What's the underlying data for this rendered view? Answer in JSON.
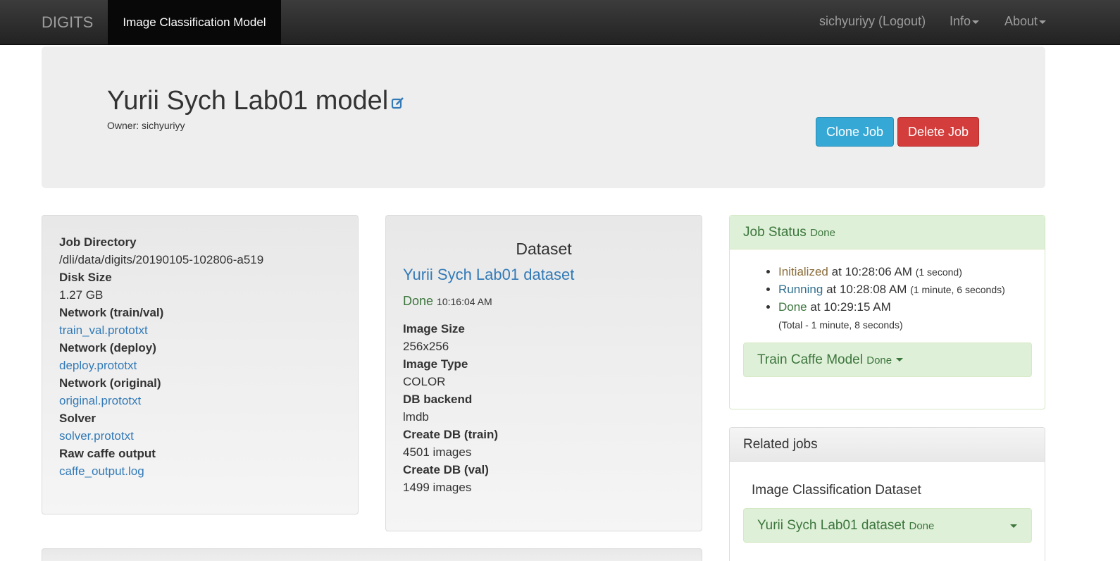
{
  "navbar": {
    "brand": "DIGITS",
    "active_tab": "Image Classification Model",
    "user": "sichyuriyy (Logout)",
    "info": "Info",
    "about": "About"
  },
  "header": {
    "title": "Yurii Sych Lab01 model",
    "owner": "Owner: sichyuriyy",
    "clone_label": "Clone Job",
    "delete_label": "Delete Job"
  },
  "job_info": {
    "items": [
      {
        "label": "Job Directory",
        "value": "/dli/data/digits/20190105-102806-a519"
      },
      {
        "label": "Disk Size",
        "value": "1.27 GB"
      },
      {
        "label": "Network (train/val)",
        "value": "train_val.prototxt"
      },
      {
        "label": "Network (deploy)",
        "value": "deploy.prototxt"
      },
      {
        "label": "Network (original)",
        "value": "original.prototxt"
      },
      {
        "label": "Solver",
        "value": "solver.prototxt"
      },
      {
        "label": "Raw caffe output",
        "value": "caffe_output.log"
      }
    ]
  },
  "dataset": {
    "heading": "Dataset",
    "name": "Yurii Sych Lab01 dataset",
    "status": "Done",
    "time": "10:16:04 AM",
    "items": [
      {
        "label": "Image Size",
        "value": "256x256"
      },
      {
        "label": "Image Type",
        "value": "COLOR"
      },
      {
        "label": "DB backend",
        "value": "lmdb"
      },
      {
        "label": "Create DB (train)",
        "value": "4501 images"
      },
      {
        "label": "Create DB (val)",
        "value": "1499 images"
      }
    ]
  },
  "job_status": {
    "title": "Job Status",
    "state": "Done",
    "events": [
      {
        "state": "Initialized",
        "at": "at 10:28:06 AM",
        "duration": "(1 second)"
      },
      {
        "state": "Running",
        "at": "at 10:28:08 AM",
        "duration": "(1 minute, 6 seconds)"
      },
      {
        "state": "Done",
        "at": "at 10:29:15 AM",
        "duration": ""
      }
    ],
    "total": "(Total - 1 minute, 8 seconds)",
    "task_name": "Train Caffe Model",
    "task_state": "Done"
  },
  "related": {
    "title": "Related jobs",
    "heading": "Image Classification Dataset",
    "job_name": "Yurii Sych Lab01 dataset",
    "job_state": "Done"
  },
  "colors": {
    "navbar": "#222222",
    "link": "#337ab7",
    "success": "#3c763d",
    "clone": "#36a8d5",
    "delete": "#d33d3b"
  }
}
